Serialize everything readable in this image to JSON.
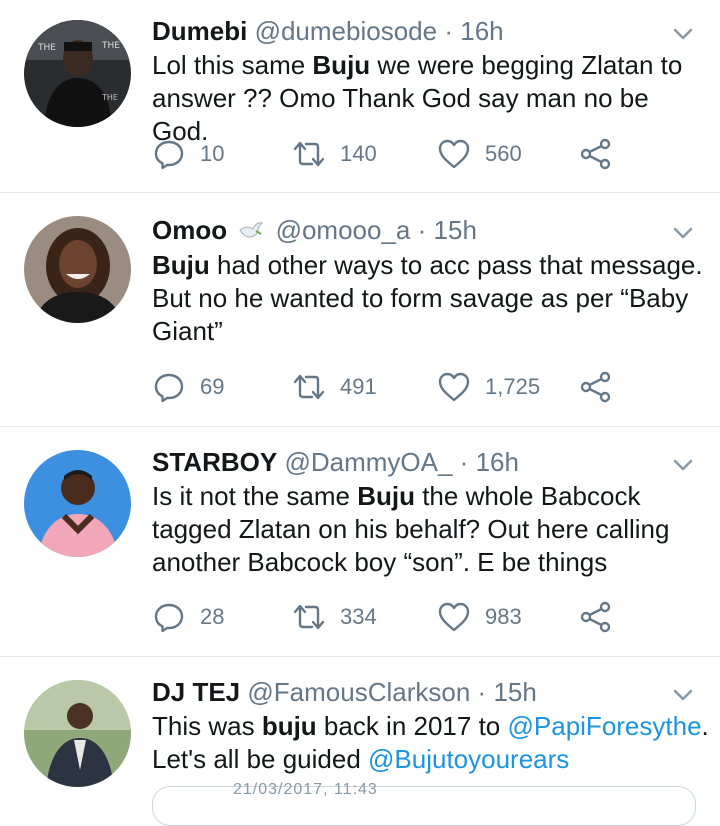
{
  "tweets": [
    {
      "name": "Dumebi",
      "handle": "@dumebiosode",
      "time": "16h",
      "text_parts": [
        "Lol this same ",
        "Buju",
        " we were begging Zlatan to answer ?? Omo Thank God say man no be God."
      ],
      "replies": "10",
      "retweets": "140",
      "likes": "560"
    },
    {
      "name": "Omoo",
      "handle": "@omooo_a",
      "time": "15h",
      "text_parts": [
        "Buju",
        " had other ways to acc pass that message. But no he wanted to form savage as per “Baby Giant”"
      ],
      "replies": "69",
      "retweets": "491",
      "likes": "1,725"
    },
    {
      "name": "STARBOY",
      "handle": "@DammyOA_",
      "time": "16h",
      "text_parts": [
        "Is it not the same ",
        "Buju",
        " the whole Babcock tagged  Zlatan on his behalf? Out here calling another Babcock boy “son”. E be things"
      ],
      "replies": "28",
      "retweets": "334",
      "likes": "983"
    },
    {
      "name": "DJ TEJ",
      "handle": "@FamousClarkson",
      "time": "15h",
      "text_parts": [
        "This was ",
        "buju",
        " back in 2017 to ",
        "@PapiForesythe",
        ".",
        "Let's all be guided ",
        "@Bujutoyourears"
      ]
    }
  ],
  "separator": "·",
  "card_partial_text": "21/03/2017, 11:43",
  "colors": {
    "accent": "#1b95e0",
    "muted": "#657786",
    "divider": "#e1e8ed"
  }
}
